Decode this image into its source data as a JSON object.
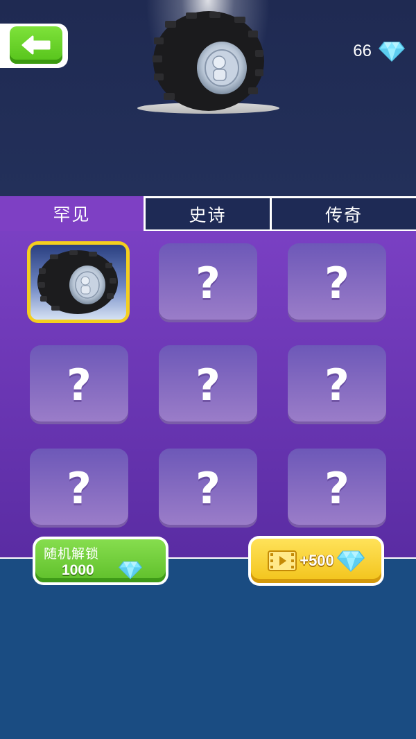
{
  "header": {
    "back_icon": "arrow-left-icon",
    "gem_count": "66",
    "gem_icon": "diamond-icon"
  },
  "tabs": [
    {
      "label": "罕见",
      "active": true
    },
    {
      "label": "史诗",
      "active": false
    },
    {
      "label": "传奇",
      "active": false
    }
  ],
  "grid": {
    "selected_slot_icon": "tire-icon",
    "locked_label": "?"
  },
  "actions": {
    "random_unlock_label": "随机解锁",
    "random_unlock_price": "1000",
    "video_reward_label": "+500",
    "video_icon": "video-film-icon"
  },
  "colors": {
    "panel_purple": "#7a40c3",
    "tab_inactive": "#1e2a55",
    "selected_border": "#f4cf1e",
    "green_button": "#5fbf2a",
    "gold_button": "#f2c31a",
    "gem_cyan": "#7fe6ff"
  }
}
